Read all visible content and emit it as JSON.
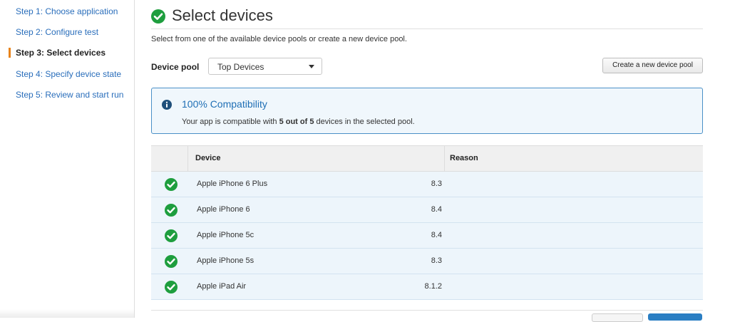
{
  "sidebar": {
    "steps": [
      {
        "label": "Step 1: Choose application"
      },
      {
        "label": "Step 2: Configure test"
      },
      {
        "label": "Step 3: Select devices"
      },
      {
        "label": "Step 4: Specify device state"
      },
      {
        "label": "Step 5: Review and start run"
      }
    ],
    "active_step": 3
  },
  "header": {
    "title": "Select devices",
    "subtitle": "Select from one of the available device pools or create a new device pool."
  },
  "pool": {
    "label": "Device pool",
    "selected": "Top Devices",
    "create_button": "Create a new device pool"
  },
  "info": {
    "title": "100% Compatibility",
    "text_prefix": "Your app is compatible with ",
    "text_bold": "5 out of 5",
    "text_suffix": " devices in the selected pool."
  },
  "table": {
    "columns": {
      "device": "Device",
      "reason": "Reason"
    },
    "rows": [
      {
        "device": "Apple iPhone 6 Plus",
        "version": "8.3"
      },
      {
        "device": "Apple iPhone 6",
        "version": "8.4"
      },
      {
        "device": "Apple iPhone 5c",
        "version": "8.4"
      },
      {
        "device": "Apple iPhone 5s",
        "version": "8.3"
      },
      {
        "device": "Apple iPad Air",
        "version": "8.1.2"
      }
    ]
  },
  "colors": {
    "link": "#2a6ebb",
    "success": "#1e9e3e",
    "info_border": "#4a90c7",
    "info_title": "#1f6fb5",
    "active_marker": "#e8831a",
    "row_bg": "#edf5fb"
  },
  "icons": {
    "title": "check-circle-icon",
    "info": "info-circle-icon",
    "row": "check-circle-icon",
    "dropdown": "caret-down-icon"
  }
}
